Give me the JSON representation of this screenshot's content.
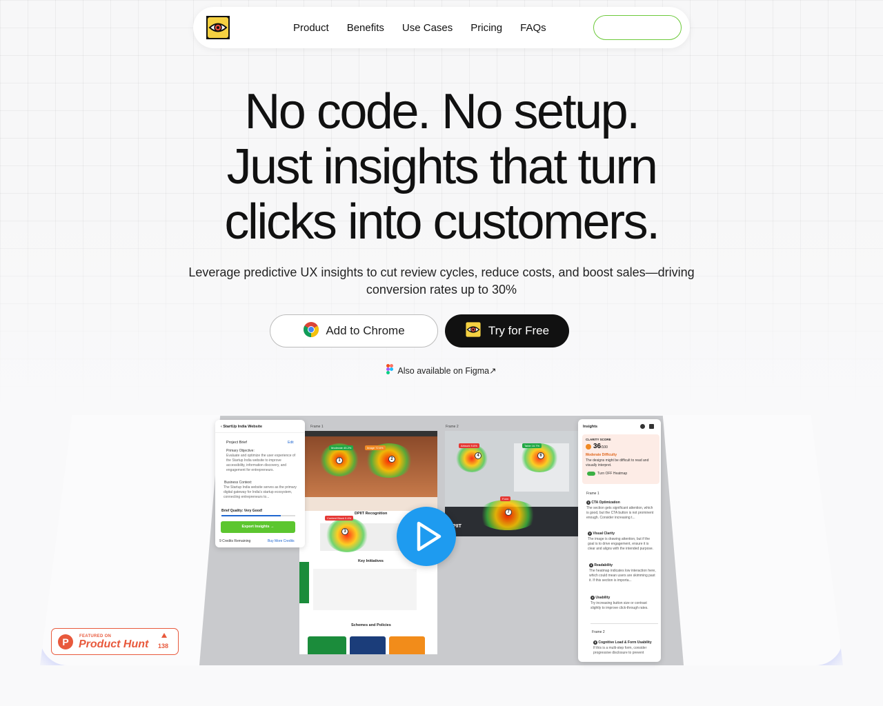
{
  "nav": {
    "links": [
      "Product",
      "Benefits",
      "Use Cases",
      "Pricing",
      "FAQs"
    ],
    "cta_label": ""
  },
  "hero": {
    "headline": [
      "No code. No setup.",
      "Just insights that turn",
      "clicks into customers."
    ],
    "subtext": "Leverage predictive UX insights to cut review cycles, reduce costs, and boost sales—driving conversion rates up to 30%",
    "add_to_chrome": "Add to Chrome",
    "try_free": "Try for Free",
    "figma_note": "Also available on Figma↗"
  },
  "preview": {
    "left_panel": {
      "title": "StartUp India Website",
      "brief_label": "Project Brief",
      "edit": "Edit",
      "objective_title": "Primary Objective:",
      "objective_text": "Evaluate and optimize the user experience of the Startup India website to improve accessibility, information discovery, and engagement for entrepreneurs.",
      "context_title": "Business Context:",
      "context_text": "The Startup India website serves as the primary digital gateway for India's startup ecosystem, connecting entrepreneurs to...",
      "quality": "Brief Quality: Very Good!",
      "export": "Export Insights →",
      "credits": "9 Credits Remaining",
      "buy": "Buy More Credits"
    },
    "frame1_label": "Frame 1",
    "frame2_label": "Frame 2",
    "frame1_tags": [
      "Moderate 45.2%",
      "Image 72.6%",
      "Content Block 0.4%"
    ],
    "frame2_tags": [
      "Artwork 9.6%",
      "Table 16.7%",
      "Form"
    ],
    "site_heading": "DPIIT Recognition",
    "site_section1": "Key Initiatives",
    "site_section2": "Schemes and Policies",
    "frame2_logo": "DPIIT",
    "right_panel": {
      "title": "Insights",
      "score_label": "CLARITY SCORE",
      "score": "36",
      "score_max": "/100",
      "difficulty": "Moderate Difficulty",
      "score_note": "The designs might be difficult to read and visually interpret.",
      "toggle_label": "Turn OFF Heatmap",
      "frame1": "Frame 1",
      "items": [
        {
          "n": "1",
          "title": "CTA Optimization",
          "text": "The section gets significant attention, which is good, but the CTA button is not prominent enough. Consider increasing t..."
        },
        {
          "n": "2",
          "title": "Visual Clarity",
          "text": "The image is drawing attention, but if the goal is to drive engagement, ensure it is clear and aligns with the intended purpose."
        },
        {
          "n": "3",
          "title": "Readability",
          "text": "The heatmap indicates low interaction here, which could mean users are skimming past it. If this section is importa..."
        },
        {
          "n": "4",
          "title": "Usability",
          "text": "Try increasing button size or contrast slightly to improve click-through rates."
        }
      ],
      "frame2": "Frame 2",
      "item5_n": "5",
      "item5_title": "Cognitive Load & Form Usability",
      "item5_text": "If this is a multi-step form, consider progressive disclosure to prevent"
    }
  },
  "product_hunt": {
    "featured": "FEATURED ON",
    "name": "Product Hunt",
    "count": "138"
  },
  "colors": {
    "accent_green": "#6cc93a",
    "play_blue": "#1e9bf0",
    "product_hunt": "#e8593c",
    "logo_yellow": "#f5d142"
  }
}
